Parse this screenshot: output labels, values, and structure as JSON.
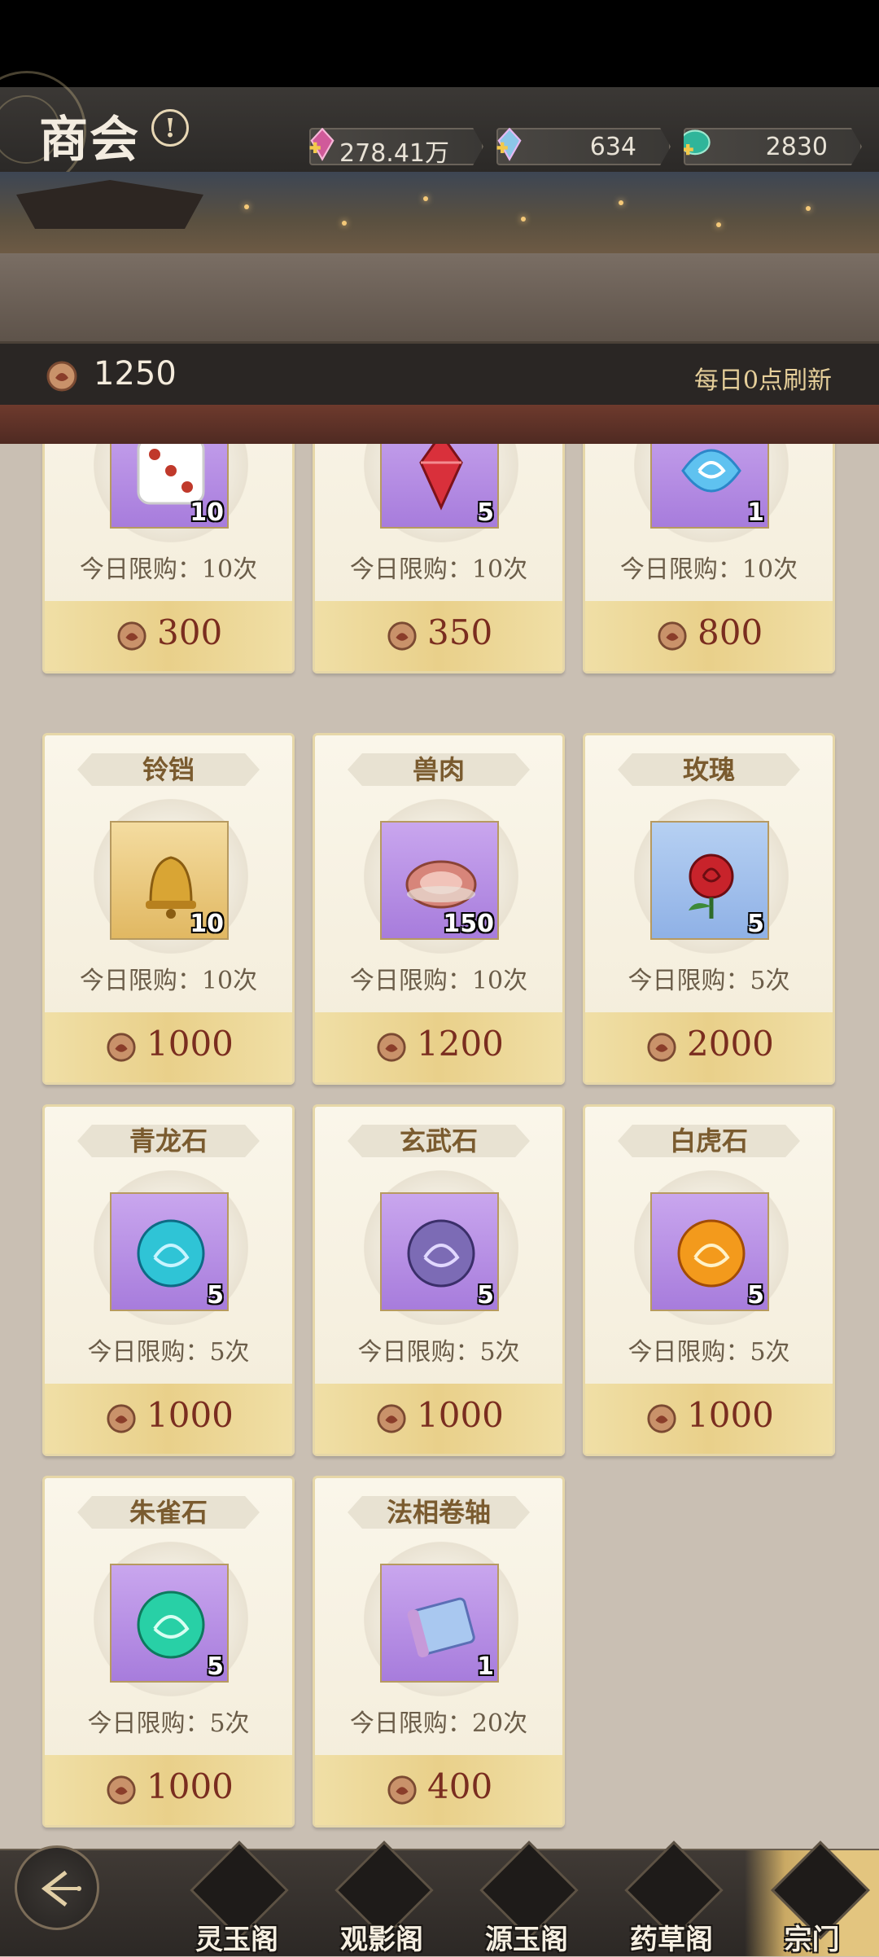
{
  "header": {
    "title": "商会",
    "info_icon": "!",
    "currencies": [
      {
        "icon": "pink-gem-icon",
        "value": "278.41万"
      },
      {
        "icon": "rainbow-gem-icon",
        "value": "634"
      },
      {
        "icon": "jade-icon",
        "value": "2830"
      }
    ]
  },
  "balance": {
    "icon": "shop-coin-icon",
    "value": "1250",
    "refresh_text": "每日0点刷新"
  },
  "items": [
    {
      "name": "",
      "icon": "dice-icon",
      "bg": "purple",
      "qty": "10",
      "limit": "今日限购：10次",
      "price": "300"
    },
    {
      "name": "",
      "icon": "red-crystal-icon",
      "bg": "purple",
      "qty": "5",
      "limit": "今日限购：10次",
      "price": "350"
    },
    {
      "name": "",
      "icon": "blue-spirit-stone-icon",
      "bg": "purple",
      "qty": "1",
      "limit": "今日限购：10次",
      "price": "800"
    },
    {
      "name": "铃铛",
      "icon": "bell-icon",
      "bg": "gold",
      "qty": "10",
      "limit": "今日限购：10次",
      "price": "1000"
    },
    {
      "name": "兽肉",
      "icon": "meat-icon",
      "bg": "purple",
      "qty": "150",
      "limit": "今日限购：10次",
      "price": "1200"
    },
    {
      "name": "玫瑰",
      "icon": "rose-icon",
      "bg": "blue",
      "qty": "5",
      "limit": "今日限购：5次",
      "price": "2000"
    },
    {
      "name": "青龙石",
      "icon": "azure-dragon-orb-icon",
      "bg": "purple",
      "qty": "5",
      "limit": "今日限购：5次",
      "price": "1000"
    },
    {
      "name": "玄武石",
      "icon": "black-tortoise-orb-icon",
      "bg": "purple",
      "qty": "5",
      "limit": "今日限购：5次",
      "price": "1000"
    },
    {
      "name": "白虎石",
      "icon": "white-tiger-orb-icon",
      "bg": "purple",
      "qty": "5",
      "limit": "今日限购：5次",
      "price": "1000"
    },
    {
      "name": "朱雀石",
      "icon": "vermilion-bird-orb-icon",
      "bg": "purple",
      "qty": "5",
      "limit": "今日限购：5次",
      "price": "1000"
    },
    {
      "name": "法相卷轴",
      "icon": "scroll-icon",
      "bg": "purple",
      "qty": "1",
      "limit": "今日限购：20次",
      "price": "400"
    }
  ],
  "colors": {
    "orb_azure": "#2fc4d6",
    "orb_tortoise": "#7c6bb5",
    "orb_tiger": "#f39a1c",
    "orb_bird": "#28d0a6",
    "price_text": "#7a2d1f"
  },
  "bottom_nav": {
    "back_icon": "back-arrow-icon",
    "items": [
      {
        "label": "灵玉阁",
        "icon": "pavilion-icon"
      },
      {
        "label": "观影阁",
        "icon": "gate-icon"
      },
      {
        "label": "源玉阁",
        "icon": "jade-beast-icon"
      },
      {
        "label": "药草阁",
        "icon": "herb-leaf-icon"
      },
      {
        "label": "宗门",
        "icon": "sect-hall-icon",
        "active": true
      }
    ]
  }
}
